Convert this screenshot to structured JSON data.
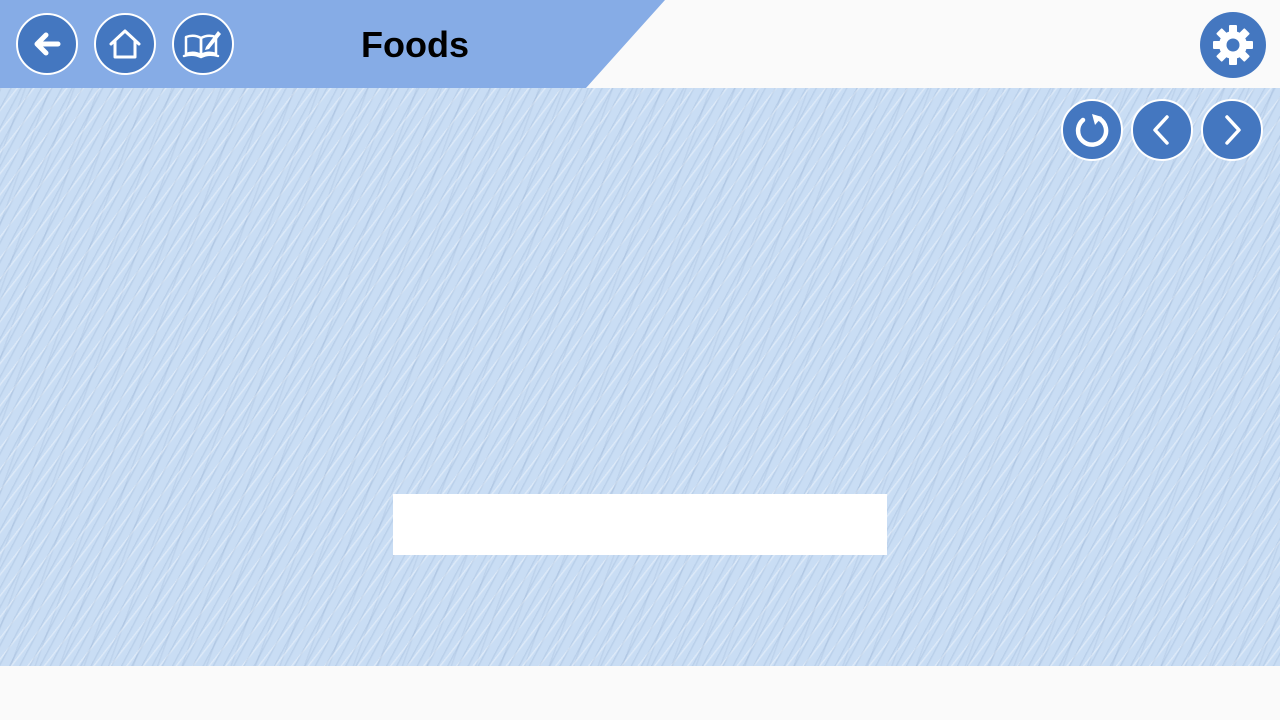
{
  "header": {
    "title": "Foods",
    "band_color": "#86ACE6",
    "buttons": [
      {
        "name": "back-button",
        "icon": "arrow-left-icon"
      },
      {
        "name": "home-button",
        "icon": "home-icon"
      },
      {
        "name": "notebook-button",
        "icon": "book-pencil-icon"
      }
    ],
    "settings_icon": "gear-icon"
  },
  "controls": {
    "reload_icon": "refresh-icon",
    "prev_icon": "chevron-left-icon",
    "next_icon": "chevron-right-icon",
    "button_color": "#4477C0"
  },
  "main": {
    "background_color": "#C9DDF4",
    "answer_field": {
      "value": "",
      "placeholder": ""
    }
  }
}
